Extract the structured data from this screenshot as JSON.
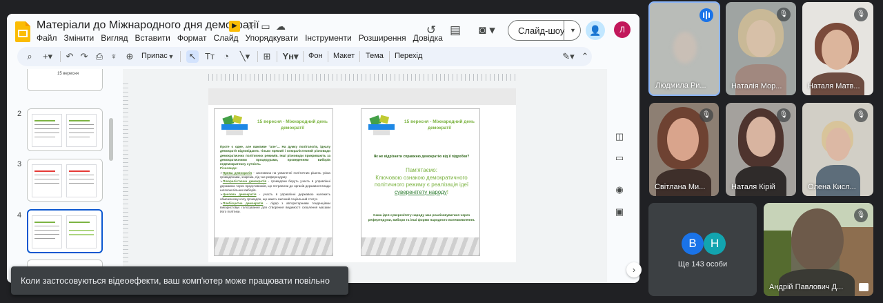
{
  "app": {
    "title": "Матеріали до Міжнародного дня  демократії",
    "menu": [
      "Файл",
      "Змінити",
      "Вигляд",
      "Вставити",
      "Формат",
      "Слайд",
      "Упорядкувати",
      "Інструменти",
      "Розширення",
      "Довідка"
    ],
    "slideshow_label": "Слайд-шоу",
    "account_initial": "Л"
  },
  "toolbar": {
    "fit_label": "Припас",
    "background_label": "Фон",
    "layout_label": "Макет",
    "theme_label": "Тема",
    "transition_label": "Перехід"
  },
  "filmstrip": {
    "slides": [
      {
        "number": "",
        "label": "15 вересня"
      },
      {
        "number": "2",
        "label": ""
      },
      {
        "number": "3",
        "label": ""
      },
      {
        "number": "4",
        "label": "",
        "selected": true
      }
    ]
  },
  "slide": {
    "left_page": {
      "title": "15 вересня - Міжнародний день демократії",
      "intro": "Проте є одне, але важливе \"але\"... На думку політологів, ідеалу демократії відповідають тільки прямий і плюралістичний різновиди демократичних політичних режимів. Інші різновиди прикривають за демократичними процедурами, проведенням виборів недемократичну сутність.",
      "types_heading": "Різновиди:",
      "items": [
        {
          "term": "Пряма демократія",
          "text": " - заснована на ухваленні політичних рішень усіма громадянами, зокрема, під час референдуму."
        },
        {
          "term": "Плюралістична демократія",
          "text": " - громадяни беруть участь в управлінні державою через представників, що потрапили до органів державної влади шляхом вільних виборів."
        },
        {
          "term": "Цензова демократія",
          "text": " - участь в управлінні державою належить обмеженому колу громадян, що мають високий соціальний статус."
        },
        {
          "term": "Плебісцитна демократія",
          "text": " - лідер з авторитарними тенденціями використовує голосування для створення видимості схвалення масами його політики."
        }
      ]
    },
    "right_page": {
      "title": "15 вересня - Міжнародний день демократії",
      "question": "Як же відрізнити справжню демократію від її підробки?",
      "remember_intro": "Пам'ятаємо:",
      "remember_body": "Ключовою ознакою демократичного політичного режиму є реалізація ідеї",
      "remember_emph": "суверенітету народу",
      "remember_end": "!",
      "note": "Сама ідея суверенітету народу має реалізовуватися через референдуми, вибори та інші форми народного волевиявлення."
    }
  },
  "toast": {
    "text": "Коли застосовуються відеоефекти, ваш комп'ютер може працювати повільно"
  },
  "meet": {
    "participants": [
      {
        "name": "Людмила Ри...",
        "speaking": true
      },
      {
        "name": "Наталія Мор...",
        "muted": true
      },
      {
        "name": "Наталя Матв...",
        "muted": true
      },
      {
        "name": "Світлана Ми...",
        "muted": true
      },
      {
        "name": "Наталя Кірій",
        "muted": true
      },
      {
        "name": "Олена Кисл...",
        "muted": true
      },
      {
        "name": "Андрій Павлович Д...",
        "muted": true
      }
    ],
    "more_avatars": [
      "В",
      "Н"
    ],
    "more_text": "Ще 143 особи",
    "colors": {
      "avatar_v": "#1a73e8",
      "avatar_n": "#12a4af",
      "speaking": "#1a73e8"
    }
  }
}
